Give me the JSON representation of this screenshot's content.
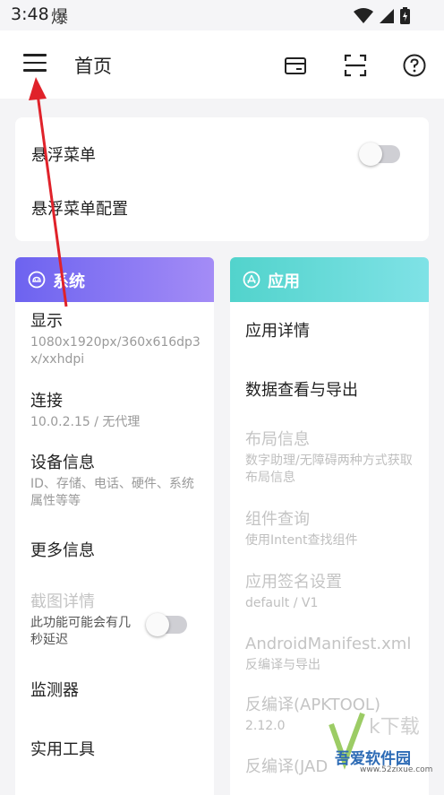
{
  "status": {
    "time": "3:48",
    "app_icon": "爆"
  },
  "header": {
    "title": "首页"
  },
  "quick_card": {
    "floating_menu_label": "悬浮菜单",
    "floating_menu_enabled": false,
    "floating_menu_config_label": "悬浮菜单配置"
  },
  "system": {
    "title": "系统",
    "items": [
      {
        "title": "显示",
        "sub": "1080x1920px/360x616dp3x/xxhdpi"
      },
      {
        "title": "连接",
        "sub": "10.0.2.15 / 无代理"
      },
      {
        "title": "设备信息",
        "sub": "ID、存储、电话、硬件、系统属性等等"
      },
      {
        "title": "更多信息",
        "sub": ""
      },
      {
        "title": "截图详情",
        "sub": "此功能可能会有几秒延迟",
        "enabled": false
      },
      {
        "title": "监测器",
        "sub": ""
      },
      {
        "title": "实用工具",
        "sub": ""
      }
    ]
  },
  "apps": {
    "title": "应用",
    "items": [
      {
        "title": "应用详情",
        "sub": ""
      },
      {
        "title": "数据查看与导出",
        "sub": ""
      },
      {
        "title": "布局信息",
        "sub": "数字助理/无障碍两种方式获取布局信息",
        "enabled": false
      },
      {
        "title": "组件查询",
        "sub": "使用Intent查找组件",
        "enabled": false
      },
      {
        "title": "应用签名设置",
        "sub": "default / V1",
        "enabled": false
      },
      {
        "title": "AndroidManifest.xml",
        "sub": "反编译与导出",
        "enabled": false
      },
      {
        "title": "反编译(APKTOOL)",
        "sub": "2.12.0",
        "enabled": false
      },
      {
        "title": "反编译(JAD",
        "sub": "",
        "enabled": false
      }
    ]
  },
  "watermark": {
    "brand": "吾爱软件园",
    "url": "www.52zixue.com"
  },
  "colors": {
    "system_header": "#7b6ff2",
    "apps_header": "#5fd8d2",
    "annotation_arrow": "#e0222a"
  }
}
